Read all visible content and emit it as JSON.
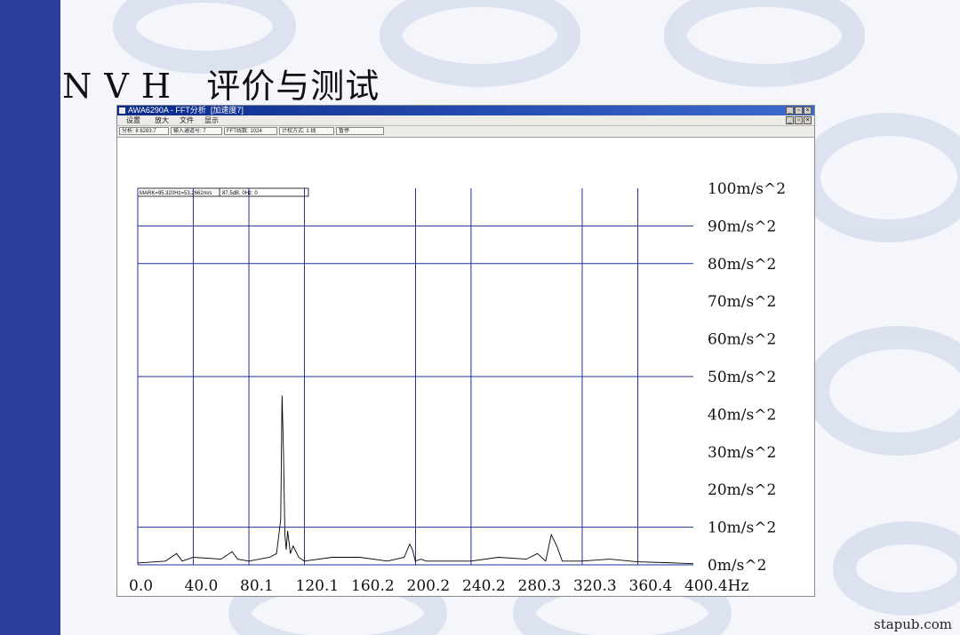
{
  "slide": {
    "title": "N V H   评价与测试",
    "site_label": "stapub.com",
    "colors": {
      "stripe": "#2d3f9b",
      "background": "#f4f6fb",
      "grid": "#1f2f9a"
    }
  },
  "window": {
    "title": "AWA6290A - FFT分析  [加速度7]",
    "buttons": {
      "minimize": "_",
      "maximize": "▫",
      "close": "×"
    },
    "icon": "app-icon"
  },
  "menu": {
    "items": [
      {
        "label": "设置"
      },
      {
        "label": "放大"
      },
      {
        "label": "文件"
      },
      {
        "label": "显示"
      }
    ]
  },
  "status_fields": [
    {
      "label": "分析: 8 6283.7"
    },
    {
      "label": "输入通道号: 7"
    },
    {
      "label": "FFT线数: 1024"
    },
    {
      "label": "计权方式: 1 线"
    },
    {
      "label": "暂停"
    }
  ],
  "marker": {
    "readout": "MARK=95.320Hz=53.2662m/s",
    "readout2": "87.5dB, 0Hz: 0"
  },
  "chart_data": {
    "type": "line",
    "title": "",
    "xlabel": "",
    "ylabel": "",
    "x_ticks": [
      "0.0",
      "40.0",
      "80.1",
      "120.1",
      "160.2",
      "200.2",
      "240.2",
      "280.3",
      "320.3",
      "360.4",
      "400.4Hz"
    ],
    "y_ticks": [
      "100m/s^2",
      "90m/s^2",
      "80m/s^2",
      "70m/s^2",
      "60m/s^2",
      "50m/s^2",
      "40m/s^2",
      "30m/s^2",
      "20m/s^2",
      "10m/s^2",
      "0m/s^2"
    ],
    "xlim": [
      0,
      400.4
    ],
    "ylim": [
      0,
      100
    ],
    "grid": true,
    "vertical_gridlines_at": [
      40.0,
      80.1,
      120.1,
      200.2,
      240.2,
      320.3,
      360.4
    ],
    "horizontal_gridlines_at": [
      10,
      50,
      80,
      90
    ],
    "series": [
      {
        "x": [
          0,
          20,
          28,
          32,
          40,
          60,
          68,
          72,
          80,
          95,
          100,
          103,
          104,
          105,
          106,
          107,
          108,
          110,
          112,
          116,
          120,
          140,
          160,
          180,
          192,
          196,
          198,
          200,
          204,
          208,
          220,
          240,
          260,
          280,
          288,
          294,
          298,
          302,
          306,
          320,
          340,
          360,
          380,
          400.4
        ],
        "y": [
          0.5,
          1.0,
          3.0,
          1.0,
          2.0,
          1.5,
          3.5,
          1.5,
          1.0,
          2.0,
          3.0,
          12.0,
          45.0,
          30.0,
          8.0,
          4.0,
          9.0,
          3.0,
          5.0,
          2.0,
          1.0,
          2.0,
          2.0,
          1.0,
          2.0,
          5.5,
          4.0,
          1.0,
          1.5,
          1.0,
          1.0,
          1.0,
          2.0,
          1.5,
          3.0,
          1.0,
          8.0,
          5.0,
          1.0,
          1.0,
          1.5,
          0.8,
          0.6,
          0.3
        ]
      }
    ]
  }
}
